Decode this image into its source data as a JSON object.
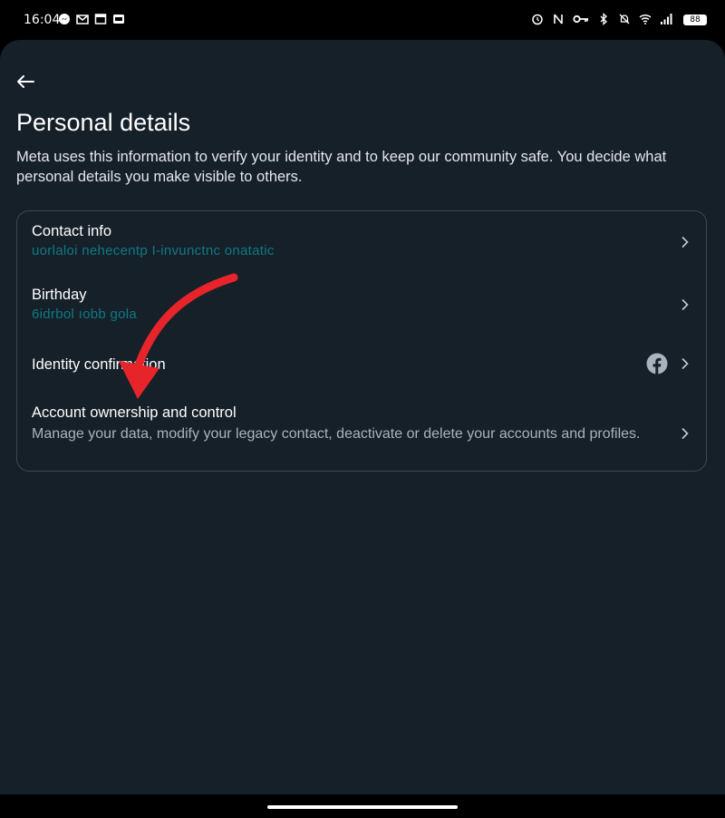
{
  "status_bar": {
    "time": "16:04",
    "battery": "88",
    "left_icons": [
      "messenger-icon",
      "gmail-icon",
      "calendar-icon",
      "sim-icon"
    ],
    "right_icons": [
      "alarm-icon",
      "nfc-icon",
      "key-icon",
      "bluetooth-icon",
      "mute-icon",
      "wifi-icon",
      "signal-icon"
    ]
  },
  "header": {
    "back_icon": "back-arrow-icon",
    "title": "Personal details",
    "description": "Meta uses this information to verify your identity and to keep our community safe. You decide what personal details you make visible to others."
  },
  "items": [
    {
      "title": "Contact info",
      "value": "uorlaloi nehecentp    I-invunctnc onatatic"
    },
    {
      "title": "Birthday",
      "value": "6idrbol ıobb gola"
    },
    {
      "title": "Identity confirmation",
      "icon": "facebook-icon"
    },
    {
      "title": "Account ownership and control",
      "description": "Manage your data, modify your legacy contact, deactivate or delete your accounts and profiles."
    }
  ],
  "colors": {
    "background": "#162029",
    "text_primary": "#ffffff",
    "text_secondary": "#a8b3bd",
    "masked_value": "#0e7a86",
    "card_border": "#3e4a54",
    "annotation_arrow": "#e8242b"
  }
}
